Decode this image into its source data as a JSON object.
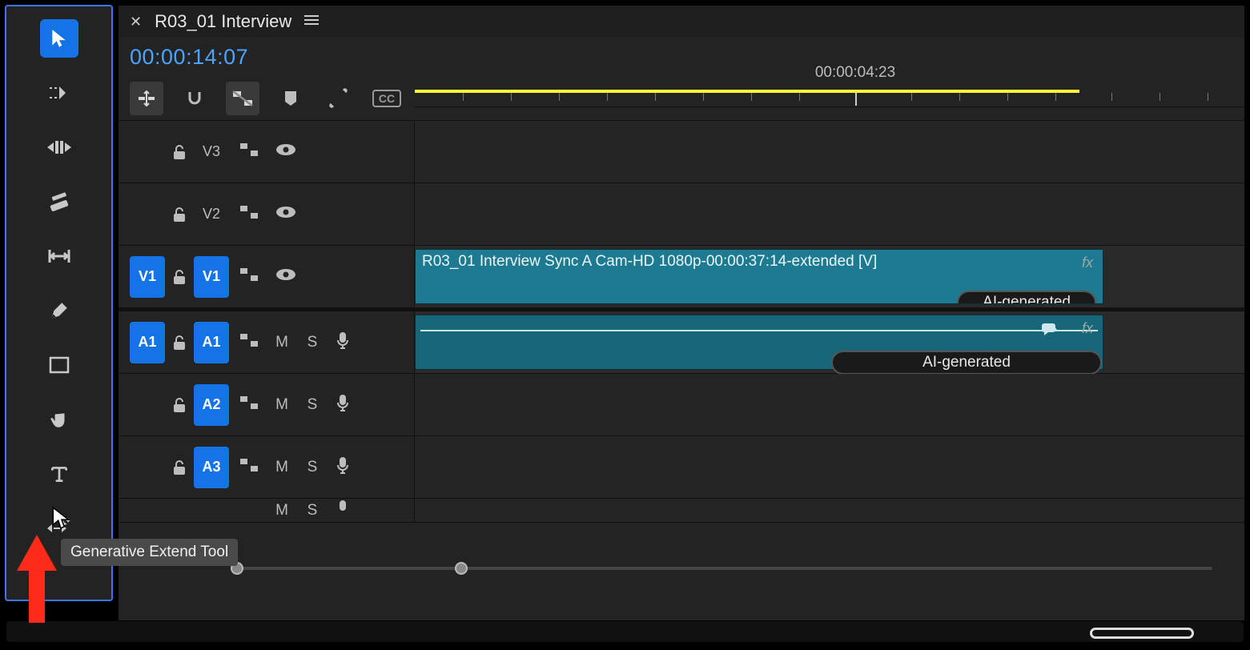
{
  "tab": {
    "title": "R03_01 Interview"
  },
  "timecode": "00:00:14:07",
  "ruler": {
    "playhead_label": "00:00:04:23"
  },
  "tracks": {
    "v3": {
      "label": "V3"
    },
    "v2": {
      "label": "V2"
    },
    "v1": {
      "source": "V1",
      "target": "V1"
    },
    "a1": {
      "source": "A1",
      "target": "A1",
      "mute": "M",
      "solo": "S"
    },
    "a2": {
      "target": "A2",
      "mute": "M",
      "solo": "S"
    },
    "a3": {
      "target": "A3",
      "mute": "M",
      "solo": "S"
    },
    "a4": {
      "mute": "M",
      "solo": "S"
    }
  },
  "clips": {
    "video": {
      "name": "R03_01 Interview Sync A Cam-HD 1080p-00:00:37:14-extended [V]",
      "fx": "fx",
      "ai_badge": "AI-generated"
    },
    "audio": {
      "fx": "fx",
      "ai_badge": "AI-generated"
    }
  },
  "tooltip": "Generative Extend Tool"
}
